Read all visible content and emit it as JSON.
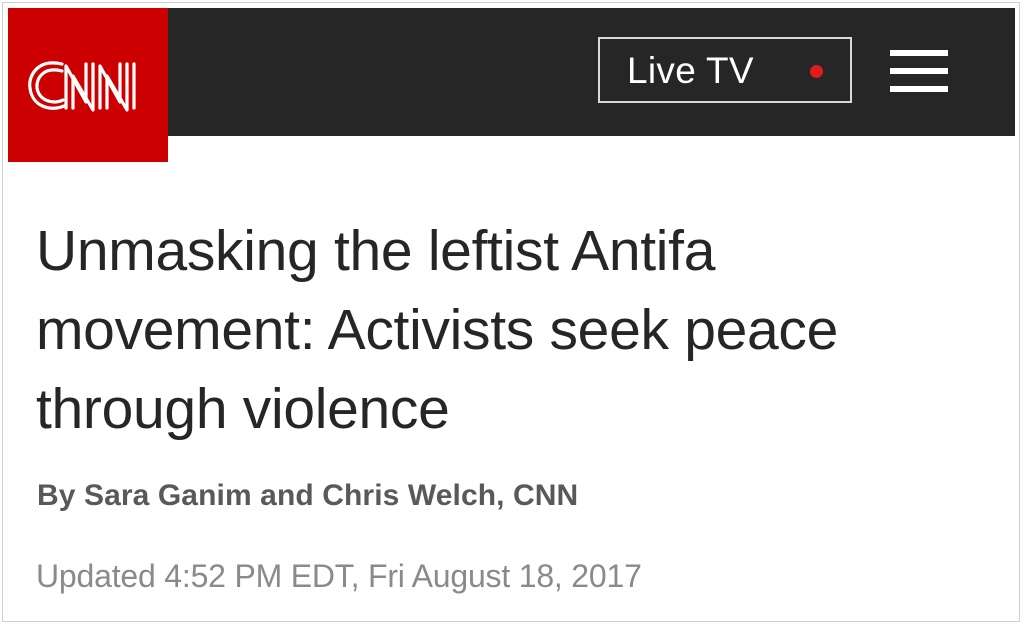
{
  "header": {
    "logo_text": "CNN",
    "live_tv_label": "Live TV",
    "brand_color": "#cc0000",
    "bar_color": "#262626",
    "live_indicator_color": "#e31b1b",
    "menu_icon": "hamburger-menu-icon"
  },
  "article": {
    "headline": "Unmasking the leftist Antifa movement: Activists seek peace through violence",
    "byline": "By Sara Ganim and Chris Welch, CNN",
    "updated": "Updated 4:52 PM EDT, Fri August 18, 2017"
  }
}
